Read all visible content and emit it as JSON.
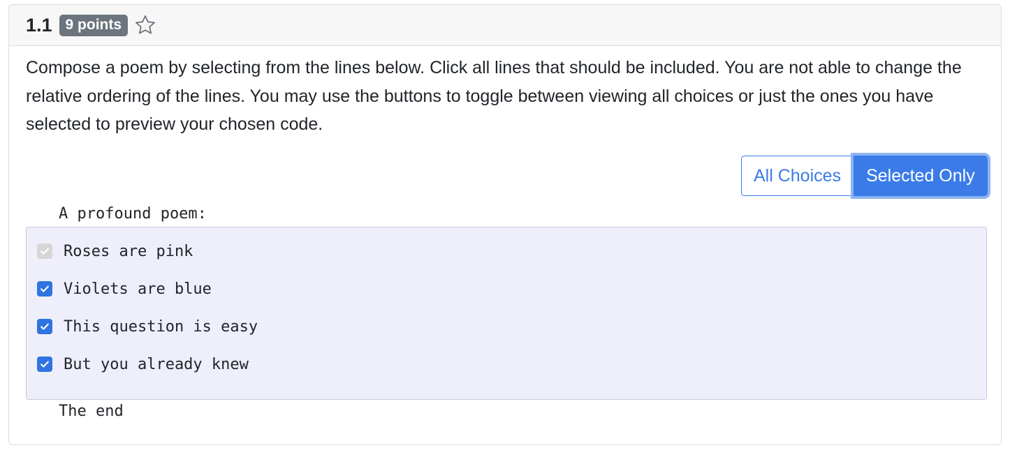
{
  "question": {
    "number": "1.1",
    "points_badge": "9 points",
    "star_icon": "star-outline-icon",
    "prompt": "Compose a poem by selecting from the lines below. Click all lines that should be included. You are not able to change the relative ordering of the lines. You may use the buttons to toggle between viewing all choices or just the ones you have selected to preview your chosen code."
  },
  "view_toggle": {
    "all_choices_label": "All Choices",
    "selected_only_label": "Selected Only",
    "active": "Selected Only"
  },
  "code": {
    "prefix": "A profound poem:",
    "suffix": "The end",
    "choices": [
      {
        "label": "Roses are pink",
        "checked": true,
        "disabled": true
      },
      {
        "label": "Violets are blue",
        "checked": true,
        "disabled": false
      },
      {
        "label": "This question is easy",
        "checked": true,
        "disabled": false
      },
      {
        "label": "But you already knew",
        "checked": true,
        "disabled": false
      }
    ]
  },
  "colors": {
    "accent": "#3b7be8",
    "badge": "#6c757d",
    "choices_background": "#efeffb"
  }
}
